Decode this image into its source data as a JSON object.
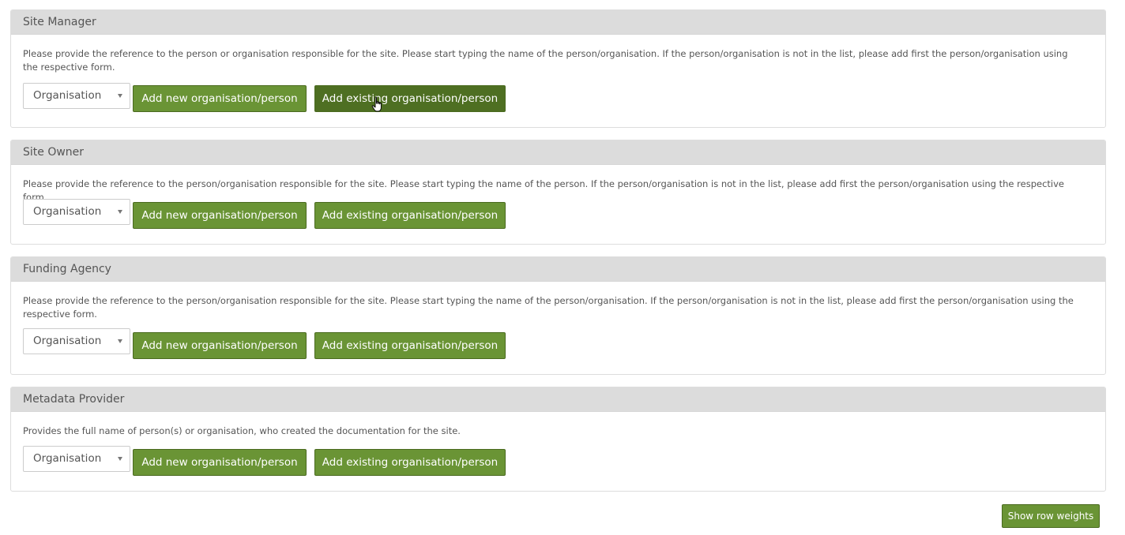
{
  "sections": [
    {
      "title": "Site Manager",
      "description": "Please provide the reference to the person or organisation responsible for the site. Please start typing the name of the person/organisation. If the person/organisation is not in the list, please add first the person/organisation using the respective form.",
      "select_value": "Organisation",
      "add_new_label": "Add new organisation/person",
      "add_existing_label": "Add existing organisation/person"
    },
    {
      "title": "Site Owner",
      "description": "Please provide the reference to the person/organisation responsible for the site. Please start typing the name of the person. If the person/organisation is not in the list, please add first the person/organisation using the respective form.",
      "select_value": "Organisation",
      "add_new_label": "Add new organisation/person",
      "add_existing_label": "Add existing organisation/person"
    },
    {
      "title": "Funding Agency",
      "description": "Please provide the reference to the person/organisation responsible for the site. Please start typing the name of the person/organisation. If the person/organisation is not in the list, please add first the person/organisation using the respective form.",
      "select_value": "Organisation",
      "add_new_label": "Add new organisation/person",
      "add_existing_label": "Add existing organisation/person"
    },
    {
      "title": "Metadata Provider",
      "description": "Provides the full name of person(s) or organisation, who created the documentation for the site.",
      "select_value": "Organisation",
      "add_new_label": "Add new organisation/person",
      "add_existing_label": "Add existing organisation/person"
    }
  ],
  "footer": {
    "show_row_weights_label": "Show row weights"
  },
  "colors": {
    "button_green": "#6a9435",
    "button_green_hover": "#4e6f22",
    "panel_heading_bg": "#dcdcdc"
  },
  "icons": {
    "select_caret": "caret-down-icon",
    "mouse_pointer": "hand-pointer-icon"
  }
}
